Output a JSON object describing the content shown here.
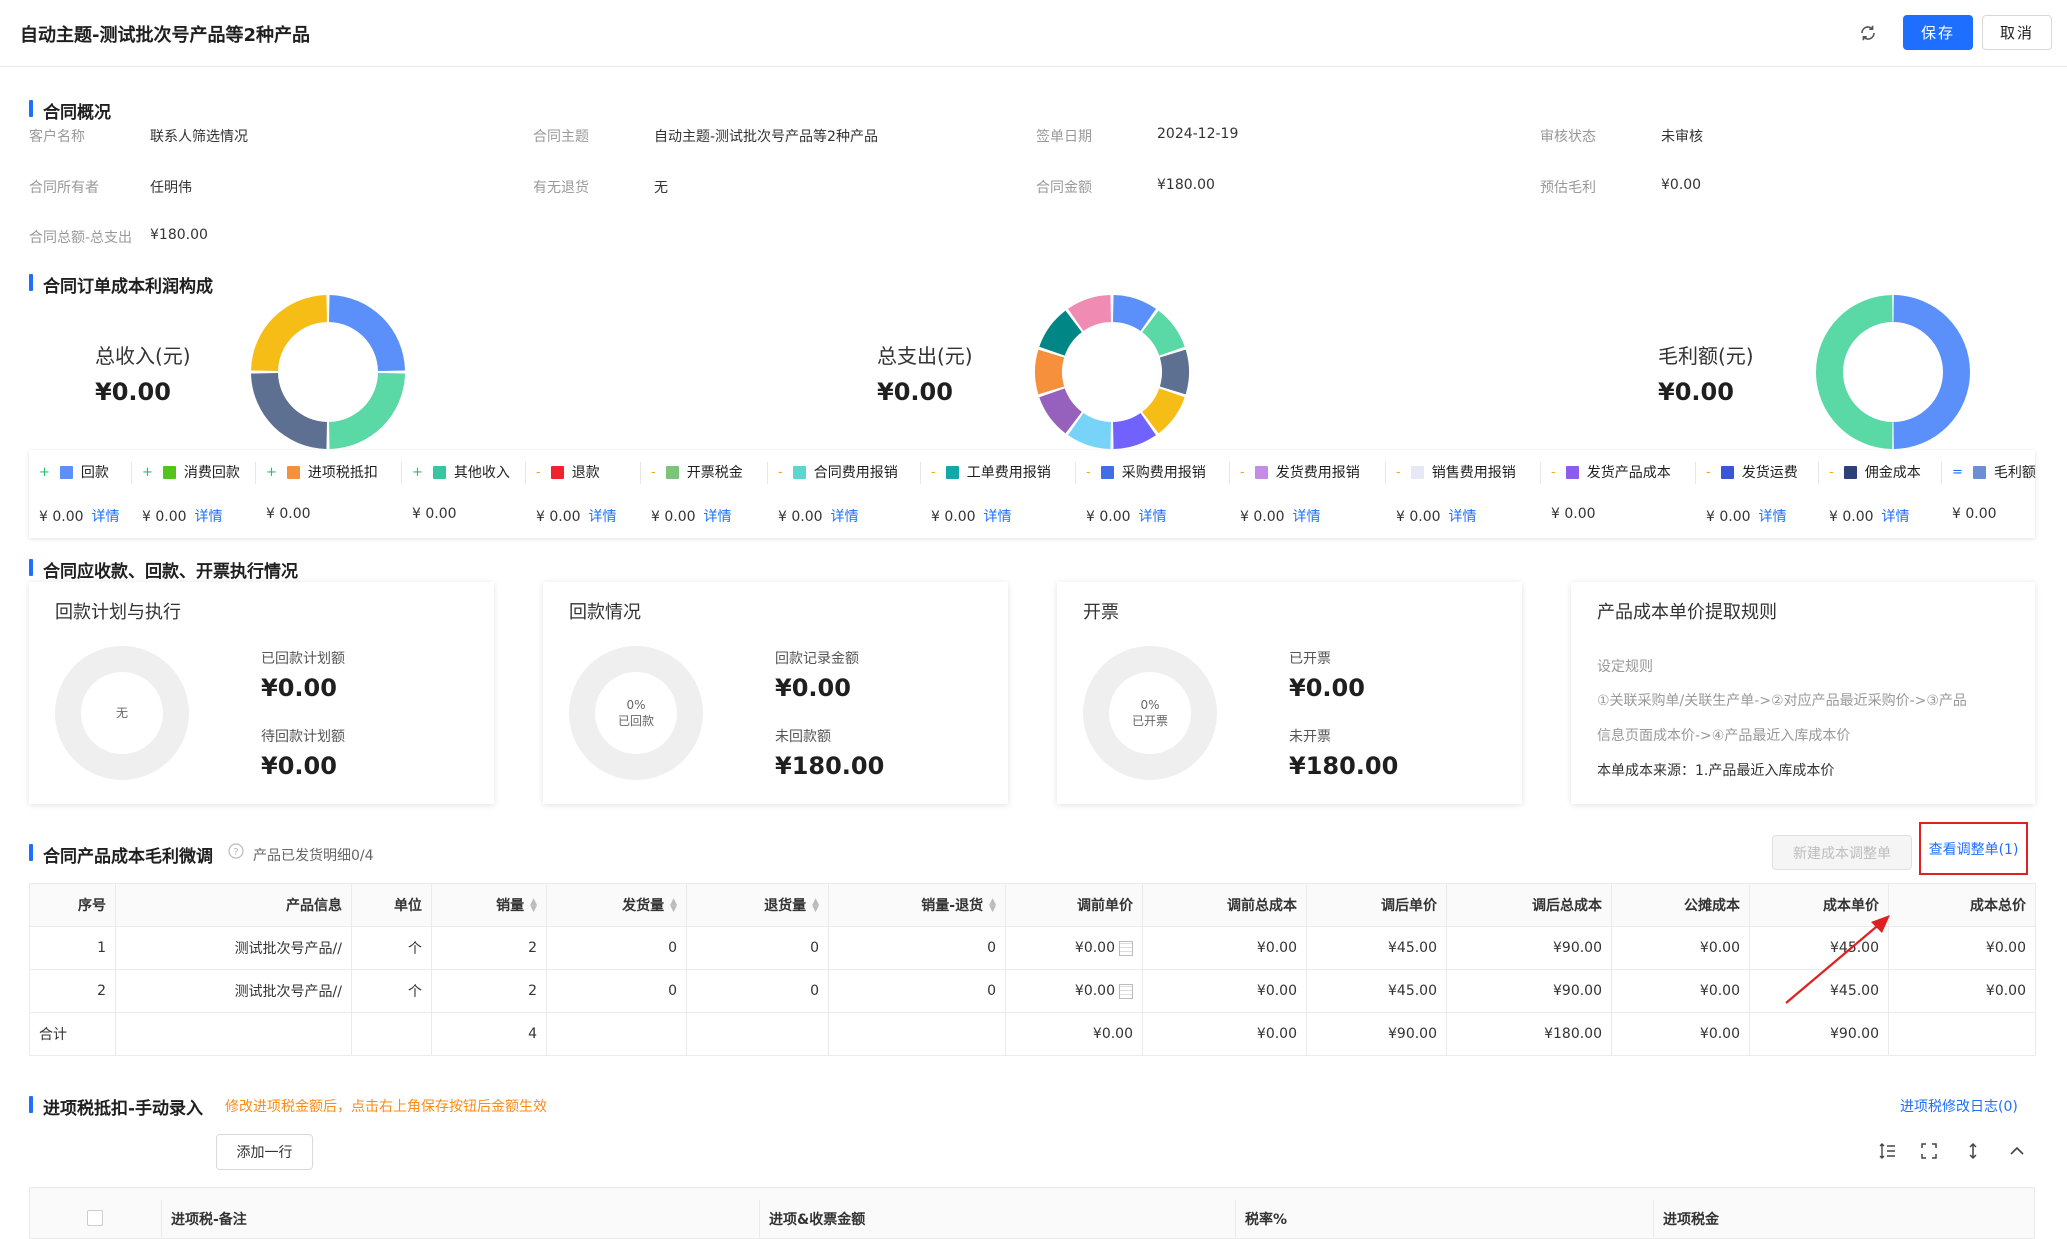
{
  "header": {
    "title": "自动主题-测试批次号产品等2种产品",
    "save": "保存",
    "cancel": "取消"
  },
  "overview": {
    "title": "合同概况",
    "fields": [
      {
        "label": "客户名称",
        "value": "联系人筛选情况"
      },
      {
        "label": "合同主题",
        "value": "自动主题-测试批次号产品等2种产品"
      },
      {
        "label": "签单日期",
        "value": "2024-12-19"
      },
      {
        "label": "审核状态",
        "value": "未审核"
      },
      {
        "label": "合同所有者",
        "value": "任明伟"
      },
      {
        "label": "有无退货",
        "value": "无"
      },
      {
        "label": "合同金额",
        "value": "¥180.00"
      },
      {
        "label": "预估毛利",
        "value": "¥0.00"
      },
      {
        "label": "合同总额-总支出",
        "value": "¥180.00"
      }
    ]
  },
  "profit": {
    "title": "合同订单成本利润构成",
    "charts": [
      {
        "label": "总收入(元)",
        "value": "¥0.00",
        "colors": [
          "#5b8ff9",
          "#5ad8a6",
          "#5d7092",
          "#f6bd16"
        ]
      },
      {
        "label": "总支出(元)",
        "value": "¥0.00",
        "colors": [
          "#5b8ff9",
          "#5ad8a6",
          "#5d7092",
          "#f6bd16",
          "#7262fd",
          "#78d3f8",
          "#9661bc",
          "#f6903d",
          "#008685",
          "#f08bb4"
        ]
      },
      {
        "label": "毛利额(元)",
        "value": "¥0.00",
        "colors": [
          "#5b8ff9",
          "#5ad8a6"
        ]
      }
    ],
    "legend": [
      {
        "sign": "+",
        "label": "回款",
        "color": "#5b8ff9",
        "value": "¥ 0.00",
        "detail": "详情"
      },
      {
        "sign": "+",
        "label": "消费回款",
        "color": "#52c41a",
        "value": "¥ 0.00",
        "detail": "详情"
      },
      {
        "sign": "+",
        "label": "进项税抵扣",
        "color": "#f6903d",
        "value": "¥ 0.00",
        "detail": ""
      },
      {
        "sign": "+",
        "label": "其他收入",
        "color": "#36c6a0",
        "value": "¥ 0.00",
        "detail": ""
      },
      {
        "sign": "-",
        "label": "退款",
        "color": "#f5222d",
        "value": "¥ 0.00",
        "detail": "详情"
      },
      {
        "sign": "-",
        "label": "开票税金",
        "color": "#7cc47a",
        "value": "¥ 0.00",
        "detail": "详情"
      },
      {
        "sign": "-",
        "label": "合同费用报销",
        "color": "#5ad8d0",
        "value": "¥ 0.00",
        "detail": "详情"
      },
      {
        "sign": "-",
        "label": "工单费用报销",
        "color": "#13a8a8",
        "value": "¥ 0.00",
        "detail": "详情"
      },
      {
        "sign": "-",
        "label": "采购费用报销",
        "color": "#3f6ee8",
        "value": "¥ 0.00",
        "detail": "详情"
      },
      {
        "sign": "-",
        "label": "发货费用报销",
        "color": "#c58be8",
        "value": "¥ 0.00",
        "detail": "详情"
      },
      {
        "sign": "-",
        "label": "销售费用报销",
        "color": "#e6e9f5",
        "value": "¥ 0.00",
        "detail": "详情"
      },
      {
        "sign": "-",
        "label": "发货产品成本",
        "color": "#8c5cf0",
        "value": "¥ 0.00",
        "detail": ""
      },
      {
        "sign": "-",
        "label": "发货运费",
        "color": "#3a55d8",
        "value": "¥ 0.00",
        "detail": "详情"
      },
      {
        "sign": "-",
        "label": "佣金成本",
        "color": "#2f3f7a",
        "value": "¥ 0.00",
        "detail": "详情"
      },
      {
        "sign": "=",
        "label": "毛利额",
        "color": "#6b8fd6",
        "value": "¥ 0.00",
        "detail": ""
      }
    ]
  },
  "execution": {
    "title": "合同应收款、回款、开票执行情况",
    "cards": [
      {
        "title": "回款计划与执行",
        "center": "无",
        "center2": "",
        "k1": "已回款计划额",
        "v1": "¥0.00",
        "k2": "待回款计划额",
        "v2": "¥0.00"
      },
      {
        "title": "回款情况",
        "center": "0%",
        "center2": "已回款",
        "k1": "回款记录金额",
        "v1": "¥0.00",
        "k2": "未回款额",
        "v2": "¥180.00"
      },
      {
        "title": "开票",
        "center": "0%",
        "center2": "已开票",
        "k1": "已开票",
        "v1": "¥0.00",
        "k2": "未开票",
        "v2": "¥180.00"
      }
    ],
    "rules": {
      "title": "产品成本单价提取规则",
      "sub": "设定规则",
      "line1": "①关联采购单/关联生产单->②对应产品最近采购价->③产品",
      "line2": "信息页面成本价->④产品最近入库成本价",
      "line3": "本单成本来源：1.产品最近入库成本价"
    }
  },
  "cost": {
    "title": "合同产品成本毛利微调",
    "hint": "产品已发货明细0/4",
    "new_btn": "新建成本调整单",
    "view_link": "查看调整单(1)",
    "columns": [
      "序号",
      "产品信息",
      "单位",
      "销量",
      "发货量",
      "退货量",
      "销量-退货",
      "调前单价",
      "调前总成本",
      "调后单价",
      "调后总成本",
      "公摊成本",
      "成本单价",
      "成本总价"
    ],
    "rows": [
      {
        "no": "1",
        "product": "测试批次号产品//",
        "unit": "个",
        "qty": "2",
        "ship": "0",
        "ret": "0",
        "net": "0",
        "pre_price": "¥0.00",
        "pre_total": "¥0.00",
        "post_price": "¥45.00",
        "post_total": "¥90.00",
        "share": "¥0.00",
        "unit_cost": "¥45.00",
        "total_cost": "¥0.00"
      },
      {
        "no": "2",
        "product": "测试批次号产品//",
        "unit": "个",
        "qty": "2",
        "ship": "0",
        "ret": "0",
        "net": "0",
        "pre_price": "¥0.00",
        "pre_total": "¥0.00",
        "post_price": "¥45.00",
        "post_total": "¥90.00",
        "share": "¥0.00",
        "unit_cost": "¥45.00",
        "total_cost": "¥0.00"
      }
    ],
    "total": {
      "label": "合计",
      "qty": "4",
      "pre_price": "¥0.00",
      "pre_total": "¥0.00",
      "post_price": "¥90.00",
      "post_total": "¥180.00",
      "share": "¥0.00",
      "unit_cost": "¥90.00"
    }
  },
  "tax": {
    "title": "进项税抵扣-手动录入",
    "warning": "修改进项税金额后，点击右上角保存按钮后金额生效",
    "log_link": "进项税修改日志(0)",
    "add_row": "添加一行",
    "columns": [
      "进项税-备注",
      "进项&收票金额",
      "税率%",
      "进项税金"
    ]
  }
}
